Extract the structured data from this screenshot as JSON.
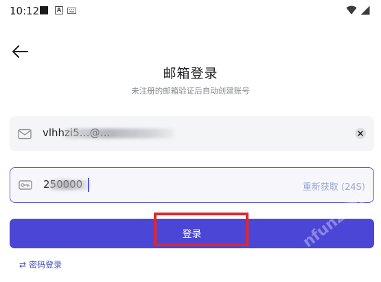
{
  "status_bar": {
    "time": "10:12",
    "icons": [
      "notification-square-icon",
      "a-icon",
      "keyboard-icon",
      "wifi-icon",
      "cellular-icon"
    ]
  },
  "header": {
    "back_icon": "arrow-left-icon",
    "title": "邮箱登录",
    "subtitle": "未注册的邮箱验证后自动创建账号"
  },
  "email_field": {
    "icon": "mail-icon",
    "value": "vlhhzi5…@…",
    "clear_icon": "clear-icon"
  },
  "code_field": {
    "icon": "key-icon",
    "value": "250000",
    "resend_label": "重新获取 (24S)"
  },
  "login_button": {
    "label": "登录"
  },
  "password_login": {
    "icon": "swap-icon",
    "label": "密码登录"
  },
  "watermark": {
    "text": "nfunz 趣网"
  },
  "colors": {
    "primary": "#4b46d6",
    "link": "#3b4fb8",
    "resend": "#9aa7d6",
    "highlight": "#e3262a",
    "field_bg": "#f4f5f7"
  }
}
